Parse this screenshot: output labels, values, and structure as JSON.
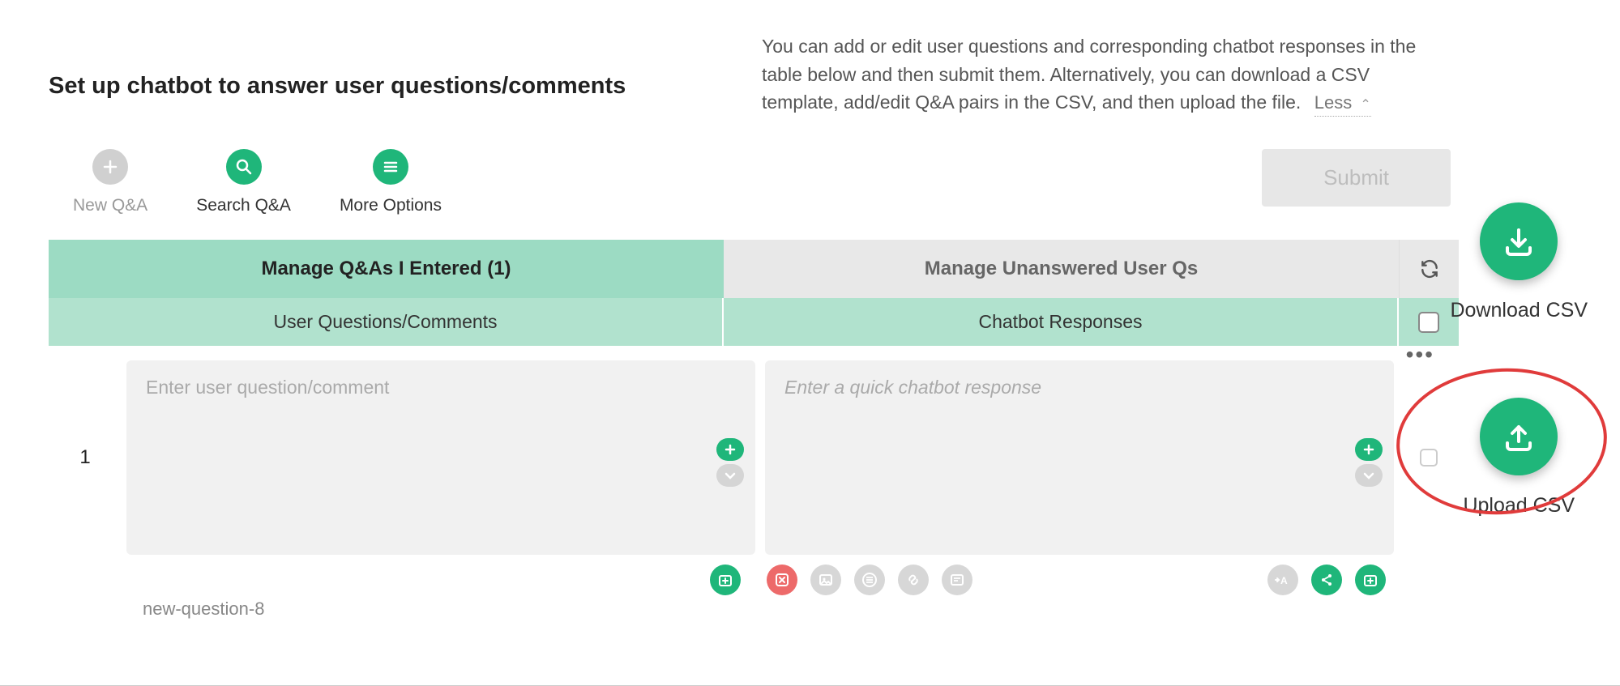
{
  "header": {
    "title": "Set up chatbot to answer user questions/comments",
    "description": "You can add or edit user questions and corresponding chatbot responses in the table below and then submit them. Alternatively, you can download a CSV template, add/edit Q&A pairs in the CSV, and then upload the file.",
    "less_label": "Less"
  },
  "toolbar": {
    "new_qa": "New Q&A",
    "search_qa": "Search Q&A",
    "more_options": "More Options",
    "submit": "Submit"
  },
  "tabs": {
    "entered": "Manage Q&As I Entered (1)",
    "unanswered": "Manage Unanswered User Qs"
  },
  "columns": {
    "questions": "User Questions/Comments",
    "responses": "Chatbot Responses"
  },
  "row": {
    "index": "1",
    "question_placeholder": "Enter user question/comment",
    "response_placeholder": "Enter a quick chatbot response",
    "topic_id": "new-question-8"
  },
  "side": {
    "download": "Download CSV",
    "upload": "Upload CSV"
  },
  "icons": {
    "plus": "plus-icon",
    "search": "search-icon",
    "menu": "menu-icon",
    "refresh": "refresh-icon",
    "add_box": "add-box-icon",
    "delete": "delete-icon",
    "image": "image-icon",
    "list": "list-icon",
    "link": "link-icon",
    "card": "card-icon",
    "autotext": "autotext-icon",
    "share": "share-icon",
    "download": "download-icon",
    "upload": "upload-icon"
  }
}
